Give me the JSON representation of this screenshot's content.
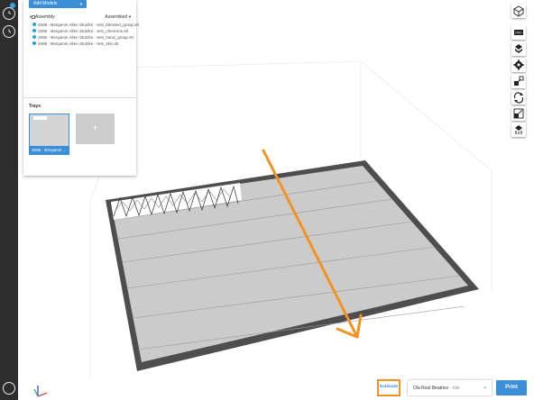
{
  "left_rail": {
    "history_badge": "1",
    "icons": [
      "clock-icon",
      "history-icon",
      "user-icon"
    ]
  },
  "models_panel": {
    "add_models_label": "Add Models",
    "assembly_label": "Assembly",
    "assembly_status": "Assembled",
    "models": [
      "2695 - Benjamin Allen Stutzke - test_blended_group.stl",
      "2695 - Benjamin Allen Stutzke - test_chevrons.stl",
      "2695 - Benjamin Allen Stutzke - test_hand_group.stl",
      "2695 - Benjamin Allen Stutzke - test_skin.stl"
    ]
  },
  "trays": {
    "title": "Trays",
    "active_tray_label": "2695 - Benjamin ...",
    "add_tray_label": "+"
  },
  "toolbar": {
    "tools": [
      "view-cube-icon",
      "material-icon",
      "layer-icon",
      "settings-gear-icon",
      "arrange-icon",
      "rotate-icon",
      "scale-icon",
      "support-icon"
    ],
    "material_label": "PRO"
  },
  "bottom_bar": {
    "estimate_label": "Estimate",
    "printer_name": "Ola Real Beatrice",
    "printer_status": "- Idle",
    "print_label": "Print"
  },
  "colors": {
    "accent": "#3a8fd6",
    "highlight": "#f39221",
    "rail_bg": "#2d2d2d",
    "bed": "#cbcbcb",
    "bed_frame": "#555555"
  }
}
